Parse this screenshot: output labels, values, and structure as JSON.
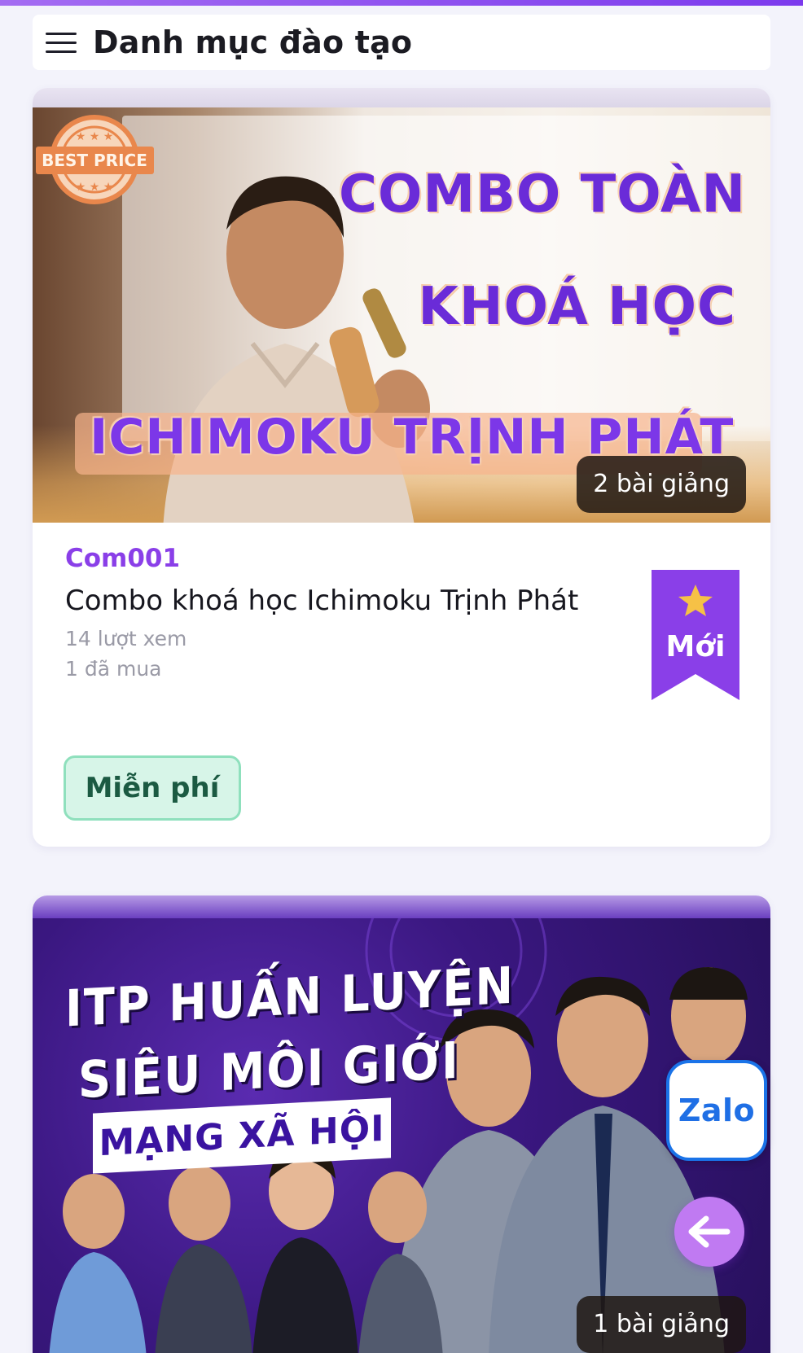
{
  "header": {
    "title": "Danh mục đào tạo",
    "menu_icon": "hamburger-menu-icon"
  },
  "courses": [
    {
      "thumbnail": {
        "badge_text": "BEST PRICE",
        "headline_line1": "COMBO TOÀN",
        "headline_line2": "KHOÁ HỌC",
        "headline_line3": "ICHIMOKU TRỊNH PHÁT"
      },
      "lessons": "2 bài giảng",
      "code": "Com001",
      "title": "Combo khoá học Ichimoku Trịnh Phát",
      "views": "14 lượt xem",
      "purchases": "1 đã mua",
      "price": "Miễn phí",
      "new_badge": "Mới"
    },
    {
      "thumbnail": {
        "headline_line1": "ITP HUẤN LUYỆN",
        "headline_line2": "SIÊU MÔI GIỚI",
        "headline_line3": "MẠNG XÃ HỘI"
      },
      "lessons": "1 bài giảng"
    }
  ],
  "floating": {
    "zalo_label": "Zalo",
    "back_icon": "arrow-left-icon"
  },
  "colors": {
    "accent": "#8a3fe8",
    "price_bg": "#d7f5e8",
    "price_text": "#1b5a42",
    "zalo_blue": "#1f6fe5",
    "back_button": "#c07af2"
  }
}
